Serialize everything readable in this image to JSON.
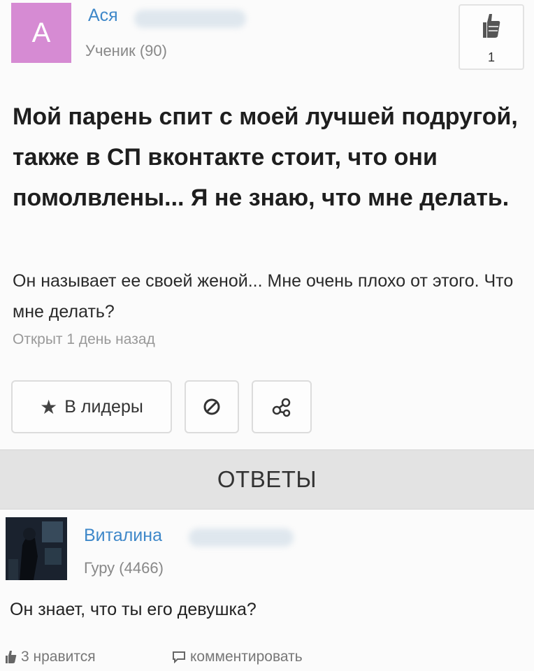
{
  "question": {
    "author": {
      "avatar_letter": "А",
      "name": "Ася",
      "rank": "Ученик (90)"
    },
    "like_count": "1",
    "title": "Мой парень спит с моей лучшей подругой, также в СП вконтакте стоит, что они помолвлены... Я не знаю, что мне делать.",
    "body": "Он называет ее своей женой... Мне очень плохо от этого. Что мне делать?",
    "time": "Открыт 1 день назад",
    "buttons": {
      "leaders": "В лидеры",
      "leaders_icon": "star-icon",
      "block_icon": "block-icon",
      "share_icon": "share-icon"
    }
  },
  "answers_header": "ОТВЕТЫ",
  "answer": {
    "author": {
      "name": "Виталина",
      "rank": "Гуру (4466)"
    },
    "text": "Он знает, что ты его девушка?",
    "likes": "3 нравится",
    "comment": "комментировать"
  },
  "colors": {
    "link": "#3f88c9",
    "avatar_bg": "#d68bd3",
    "answers_bar": "#e3e3e3"
  }
}
